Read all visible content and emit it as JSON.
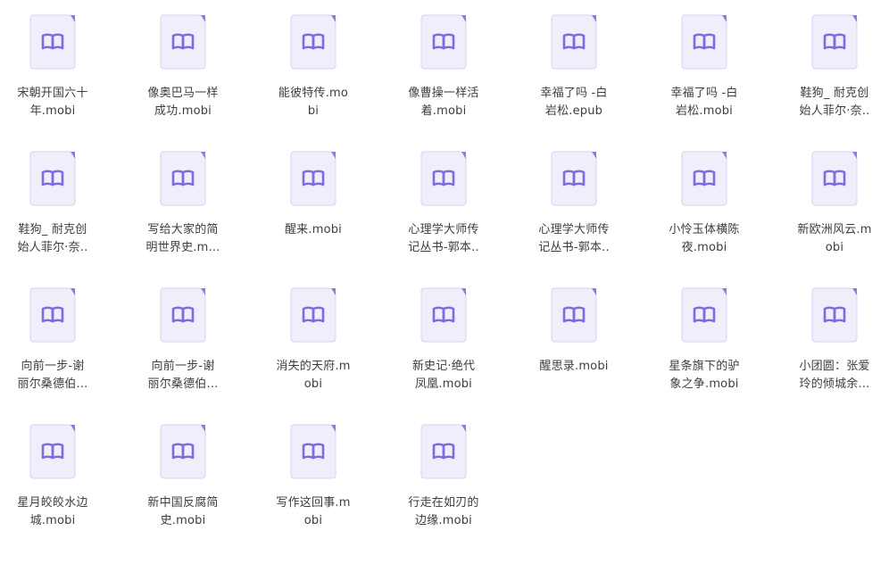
{
  "files": [
    {
      "name": "宋朝开国六十\n年.mobi",
      "icon": "ebook-icon"
    },
    {
      "name": "像奥巴马一样\n成功.mobi",
      "icon": "ebook-icon"
    },
    {
      "name": "能彼特传.mo\nbi",
      "icon": "ebook-icon"
    },
    {
      "name": "像曹操一样活\n着.mobi",
      "icon": "ebook-icon"
    },
    {
      "name": "幸福了吗 -白\n岩松.epub",
      "icon": "ebook-icon"
    },
    {
      "name": "幸福了吗 -白\n岩松.mobi",
      "icon": "ebook-icon"
    },
    {
      "name": "鞋狗_ 耐克创\n始人菲尔·奈..",
      "icon": "ebook-icon"
    },
    {
      "name": "鞋狗_ 耐克创\n始人菲尔·奈..",
      "icon": "ebook-icon"
    },
    {
      "name": "写给大家的简\n明世界史.m...",
      "icon": "ebook-icon"
    },
    {
      "name": "醒来.mobi",
      "icon": "ebook-icon"
    },
    {
      "name": "心理学大师传\n记丛书-郭本..",
      "icon": "ebook-icon"
    },
    {
      "name": "心理学大师传\n记丛书-郭本..",
      "icon": "ebook-icon"
    },
    {
      "name": "小怜玉体横陈\n夜.mobi",
      "icon": "ebook-icon"
    },
    {
      "name": "新欧洲风云.m\nobi",
      "icon": "ebook-icon"
    },
    {
      "name": "向前一步-谢\n丽尔桑德伯...",
      "icon": "ebook-icon"
    },
    {
      "name": "向前一步-谢\n丽尔桑德伯...",
      "icon": "ebook-icon"
    },
    {
      "name": "消失的天府.m\nobi",
      "icon": "ebook-icon"
    },
    {
      "name": "新史记·绝代\n凤凰.mobi",
      "icon": "ebook-icon"
    },
    {
      "name": "醒思录.mobi",
      "icon": "ebook-icon"
    },
    {
      "name": "星条旗下的驴\n象之争.mobi",
      "icon": "ebook-icon"
    },
    {
      "name": "小团圆：张爱\n玲的倾城余...",
      "icon": "ebook-icon"
    },
    {
      "name": "星月皎皎水边\n城.mobi",
      "icon": "ebook-icon"
    },
    {
      "name": "新中国反腐简\n史.mobi",
      "icon": "ebook-icon"
    },
    {
      "name": "写作这回事.m\nobi",
      "icon": "ebook-icon"
    },
    {
      "name": "行走在如刃的\n边缘.mobi",
      "icon": "ebook-icon"
    }
  ],
  "colors": {
    "page_bg": "#f1eefc",
    "page_border": "#d8d2f4",
    "book_stroke": "#7b6ce0",
    "fold_accent": "#8a7be6"
  }
}
